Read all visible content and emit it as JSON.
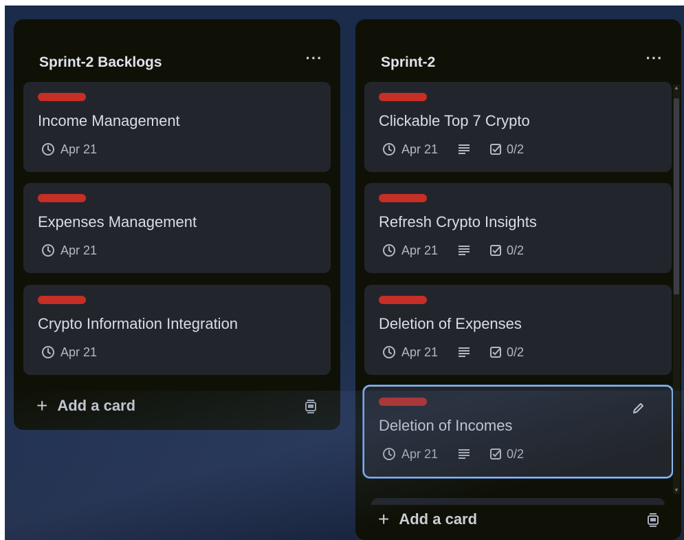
{
  "lists": [
    {
      "title": "Sprint-2 Backlogs",
      "menu": "···",
      "cards": [
        {
          "title": "Income Management",
          "date": "Apr 21"
        },
        {
          "title": "Expenses Management",
          "date": "Apr 21"
        },
        {
          "title": "Crypto Information Integration",
          "date": "Apr 21"
        }
      ],
      "add_card": "Add a card"
    },
    {
      "title": "Sprint-2",
      "menu": "···",
      "cards": [
        {
          "title": "Clickable Top 7 Crypto",
          "date": "Apr 21",
          "checklist": "0/2"
        },
        {
          "title": "Refresh Crypto Insights",
          "date": "Apr 21",
          "checklist": "0/2"
        },
        {
          "title": "Deletion of Expenses",
          "date": "Apr 21",
          "checklist": "0/2"
        },
        {
          "title": "Deletion of Incomes",
          "date": "Apr 21",
          "checklist": "0/2"
        }
      ],
      "add_card": "Add a card"
    }
  ],
  "colors": {
    "label": "#c62e26",
    "list_bg": "#0f1106",
    "card_bg": "#22262c",
    "selected_border": "#8fb8ee"
  },
  "icons": [
    "clock-icon",
    "description-icon",
    "checklist-icon",
    "edit-icon",
    "card-template-icon",
    "more-icon",
    "plus-icon"
  ]
}
